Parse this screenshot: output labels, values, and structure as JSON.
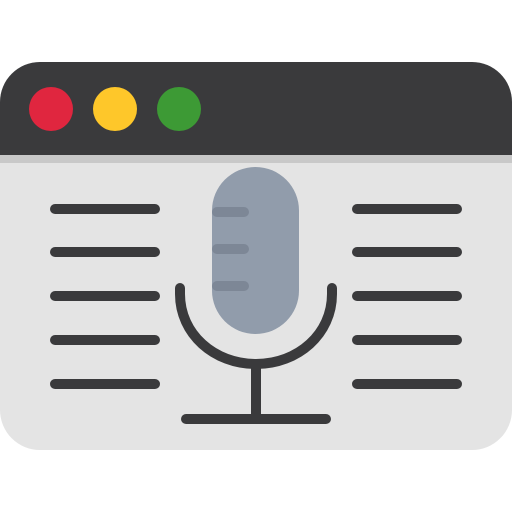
{
  "window": {
    "colors": {
      "titlebar": "#3a3a3c",
      "body": "#e4e4e4",
      "divider": "#c8c8c8",
      "lines": "#3a3a3c",
      "mic_head": "#919cab",
      "mic_stroke": "#3a3a3c"
    },
    "controls": [
      {
        "name": "close",
        "color": "#e0263f"
      },
      {
        "name": "minimize",
        "color": "#fec72a"
      },
      {
        "name": "maximize",
        "color": "#3d9a35"
      }
    ]
  },
  "icons": {
    "main": "microphone-icon",
    "left_text": "text-lines-icon",
    "right_text": "text-lines-icon"
  }
}
